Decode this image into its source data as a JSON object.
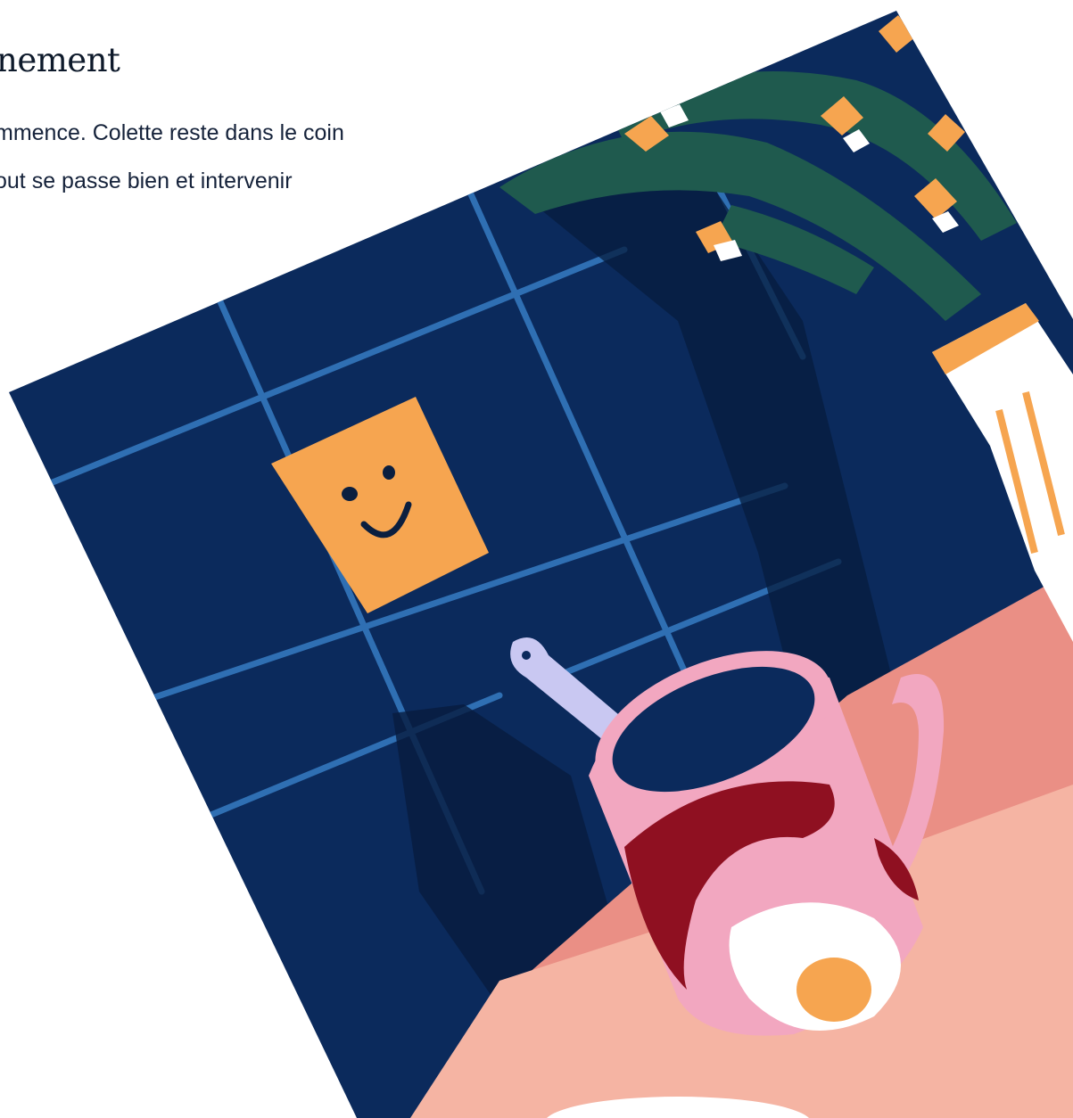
{
  "article": {
    "heading": "nement",
    "body_lines": [
      "mmence. Colette reste dans le coin",
      "out se passe bien et intervenir"
    ]
  },
  "illustration": {
    "subject": "coffee-mug-on-kitchen-counter",
    "colors": {
      "tiles": "#0b2a5c",
      "grout": "#2f6fb3",
      "counter": "#f4a892",
      "sticky_note": "#f6a550",
      "flower_leaves": "#1f5a4e",
      "mug": "#f2a7c0",
      "mug_pattern": "#8f1021",
      "spoon": "#c9c8f2"
    }
  }
}
